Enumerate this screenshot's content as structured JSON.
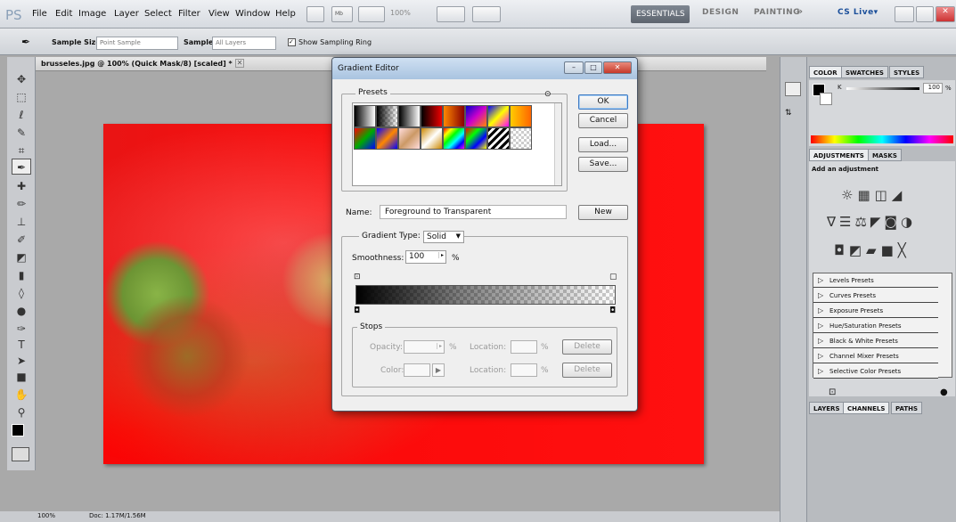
{
  "app": {
    "logo": "PS"
  },
  "menu": [
    "File",
    "Edit",
    "Image",
    "Layer",
    "Select",
    "Filter",
    "View",
    "Window",
    "Help"
  ],
  "zoom_display": "100%",
  "workspaces": {
    "essentials": "ESSENTIALS",
    "design": "DESIGN",
    "painting": "PAINTING",
    "more": "»",
    "cslive": "CS Live▾"
  },
  "options": {
    "sample_size_label": "Sample Size:",
    "sample_size_value": "Point Sample",
    "sample_label": "Sample:",
    "sample_value": "All Layers",
    "show_ring_label": "Show Sampling Ring",
    "show_ring_checked": true
  },
  "document": {
    "tab_title": "brusseles.jpg @ 100% (Quick Mask/8) [scaled] *"
  },
  "status": {
    "zoom": "100%",
    "doc": "Doc: 1.17M/1.56M"
  },
  "dialog": {
    "title": "Gradient Editor",
    "presets_label": "Presets",
    "buttons": {
      "ok": "OK",
      "cancel": "Cancel",
      "load": "Load...",
      "save": "Save...",
      "new": "New"
    },
    "name_label": "Name:",
    "name_value": "Foreground to Transparent",
    "gradient_type_label": "Gradient Type:",
    "gradient_type_value": "Solid",
    "smoothness_label": "Smoothness:",
    "smoothness_value": "100",
    "smoothness_unit": "%",
    "stops_label": "Stops",
    "opacity_label": "Opacity:",
    "opacity_unit": "%",
    "location_label": "Location:",
    "location_unit": "%",
    "color_label": "Color:",
    "delete_label": "Delete"
  },
  "panels": {
    "color_tabs": [
      "COLOR",
      "SWATCHES",
      "STYLES"
    ],
    "k_label": "K",
    "k_value": "100",
    "k_unit": "%",
    "adj_tabs": [
      "ADJUSTMENTS",
      "MASKS"
    ],
    "add_adjustment": "Add an adjustment",
    "presets": [
      "Levels Presets",
      "Curves Presets",
      "Exposure Presets",
      "Hue/Saturation Presets",
      "Black & White Presets",
      "Channel Mixer Presets",
      "Selective Color Presets"
    ],
    "bottom_tabs": [
      "LAYERS",
      "CHANNELS",
      "PATHS"
    ]
  }
}
